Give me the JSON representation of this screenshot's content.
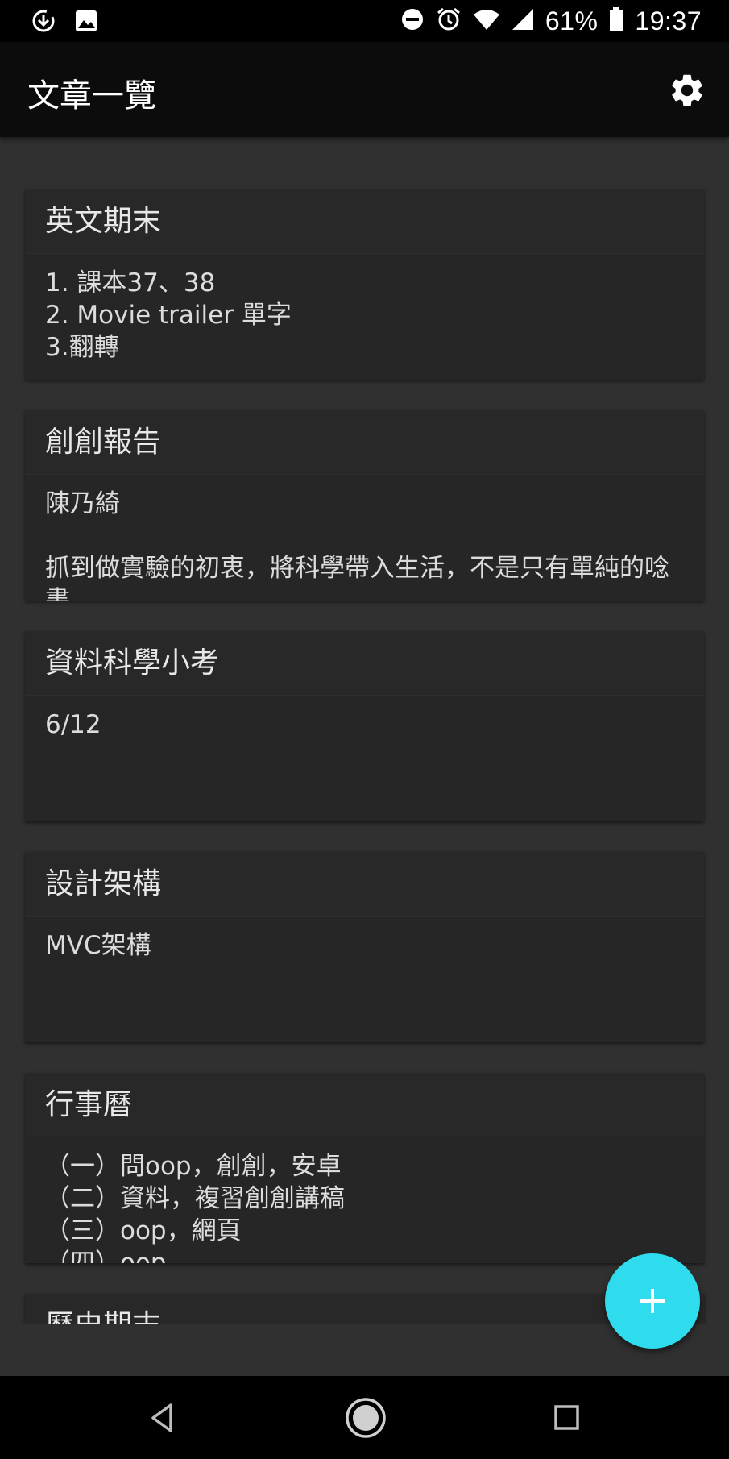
{
  "status_bar": {
    "battery": "61%",
    "time": "19:37",
    "icons": [
      "download-icon",
      "image-icon",
      "dnd-icon",
      "alarm-icon",
      "wifi-icon",
      "signal-icon",
      "battery-icon"
    ]
  },
  "app_bar": {
    "title": "文章一覽",
    "settings_icon": "gear-icon"
  },
  "articles": [
    {
      "title": "英文期末",
      "body": "1. 課本37、38\n2. Movie trailer 單字\n3.翻轉"
    },
    {
      "title": "創創報告",
      "body": "陳乃綺\n\n抓到做實驗的初衷，將科學帶入生活，不是只有單純的唸書"
    },
    {
      "title": "資料科學小考",
      "body": "6/12"
    },
    {
      "title": "設計架構",
      "body": "MVC架構"
    },
    {
      "title": "行事曆",
      "body": "（一）問oop，創創，安卓\n（二）資料，複習創創講稿\n（三）oop，網頁\n（四）oop"
    },
    {
      "title": "歷史期末",
      "body": ""
    }
  ],
  "fab": {
    "icon": "plus-icon",
    "color": "#2fdcee"
  },
  "nav_bar": {
    "icons": [
      "back-icon",
      "home-icon",
      "recents-icon"
    ]
  }
}
